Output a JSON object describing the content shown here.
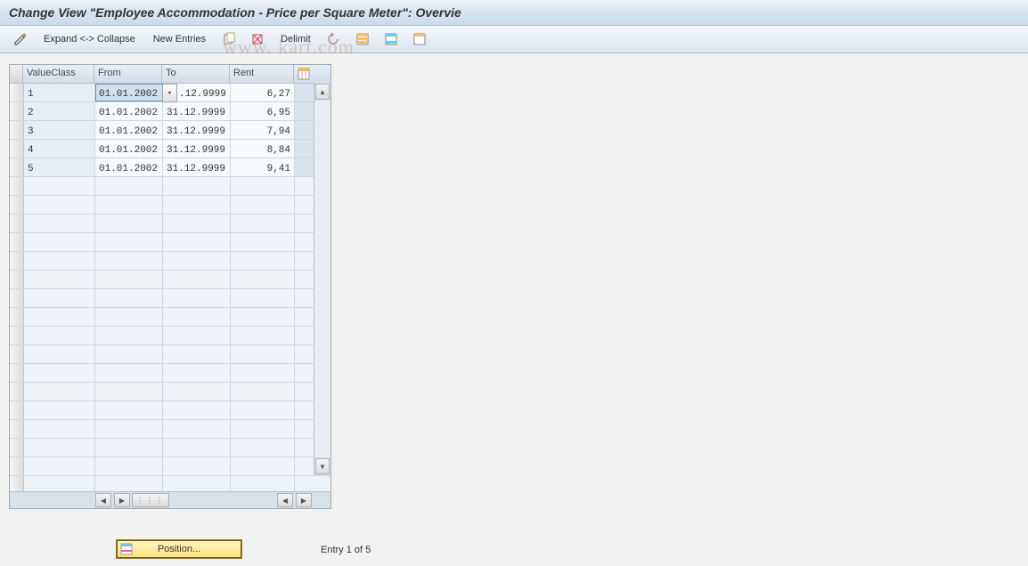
{
  "title": "Change View \"Employee Accommodation - Price per Square Meter\": Overvie",
  "watermark": "www.             kart.com",
  "toolbar": {
    "expand_collapse": "Expand <-> Collapse",
    "new_entries": "New Entries",
    "delimit": "Delimit"
  },
  "table": {
    "headers": {
      "value_class": "ValueClass",
      "from": "From",
      "to": "To",
      "rent": "Rent"
    },
    "rows": [
      {
        "value_class": "1",
        "from": "01.01.2002",
        "to": ".12.9999",
        "rent": "6,27",
        "from_selected": true,
        "f4_in_to": true
      },
      {
        "value_class": "2",
        "from": "01.01.2002",
        "to": "31.12.9999",
        "rent": "6,95"
      },
      {
        "value_class": "3",
        "from": "01.01.2002",
        "to": "31.12.9999",
        "rent": "7,94"
      },
      {
        "value_class": "4",
        "from": "01.01.2002",
        "to": "31.12.9999",
        "rent": "8,84"
      },
      {
        "value_class": "5",
        "from": "01.01.2002",
        "to": "31.12.9999",
        "rent": "9,41"
      }
    ],
    "empty_row_count": 18
  },
  "footer": {
    "position_button": "Position...",
    "status": "Entry 1 of 5"
  },
  "colors": {
    "header_grad_top": "#eef3f9",
    "header_grad_bot": "#c9dbed",
    "accent_yellow": "#ffe27a"
  }
}
